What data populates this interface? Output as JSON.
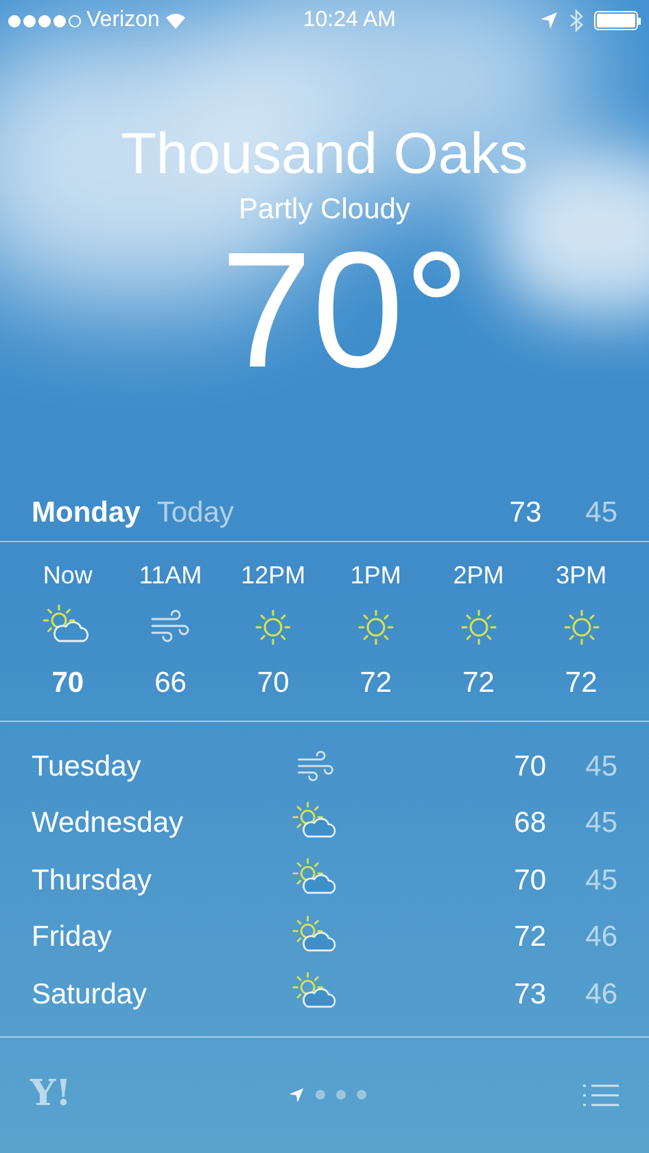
{
  "status_bar": {
    "carrier": "Verizon",
    "time": "10:24 AM"
  },
  "location": {
    "city": "Thousand Oaks",
    "condition": "Partly Cloudy",
    "temperature": "70°"
  },
  "today": {
    "day": "Monday",
    "label": "Today",
    "high": "73",
    "low": "45"
  },
  "hourly": [
    {
      "time": "Now",
      "kind": "partly-cloudy",
      "temp": "70",
      "current": true
    },
    {
      "time": "11AM",
      "kind": "wind",
      "temp": "66",
      "current": false
    },
    {
      "time": "12PM",
      "kind": "sunny",
      "temp": "70",
      "current": false
    },
    {
      "time": "1PM",
      "kind": "sunny",
      "temp": "72",
      "current": false
    },
    {
      "time": "2PM",
      "kind": "sunny",
      "temp": "72",
      "current": false
    },
    {
      "time": "3PM",
      "kind": "sunny",
      "temp": "72",
      "current": false
    }
  ],
  "daily": [
    {
      "day": "Tuesday",
      "kind": "wind",
      "high": "70",
      "low": "45"
    },
    {
      "day": "Wednesday",
      "kind": "partly-cloudy",
      "high": "68",
      "low": "45"
    },
    {
      "day": "Thursday",
      "kind": "partly-cloudy",
      "high": "70",
      "low": "45"
    },
    {
      "day": "Friday",
      "kind": "partly-cloudy",
      "high": "72",
      "low": "46"
    },
    {
      "day": "Saturday",
      "kind": "partly-cloudy",
      "high": "73",
      "low": "46"
    }
  ],
  "bottom_bar": {
    "logo": "Y!"
  }
}
